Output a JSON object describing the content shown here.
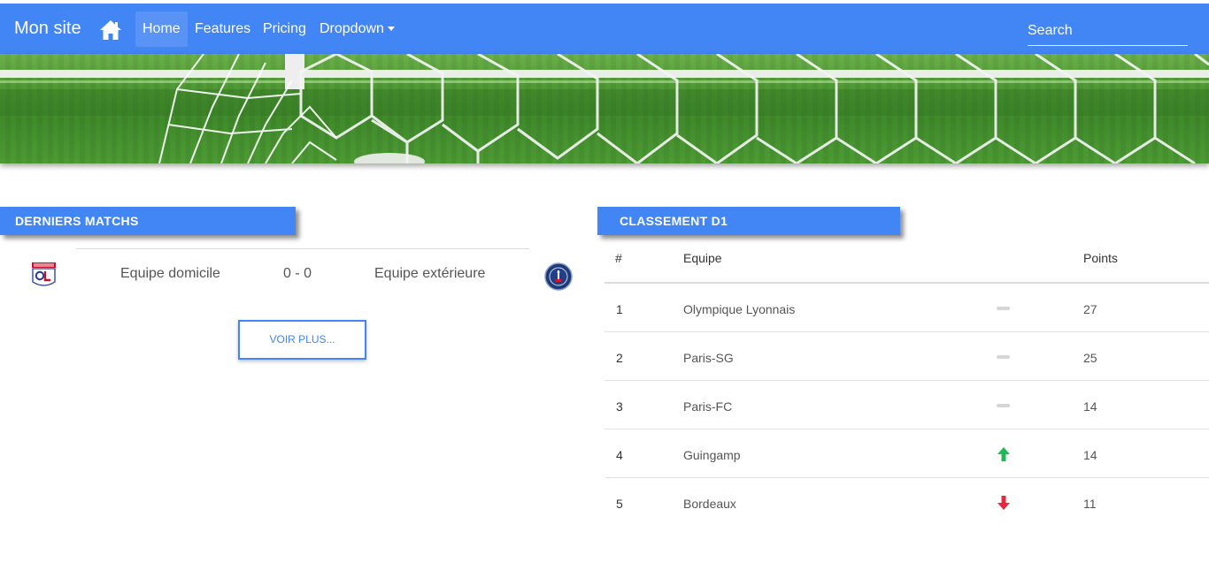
{
  "navbar": {
    "brand": "Mon site",
    "home_icon": "home-icon",
    "items": [
      {
        "label": "Home",
        "active": true
      },
      {
        "label": "Features"
      },
      {
        "label": "Pricing"
      },
      {
        "label": "Dropdown"
      }
    ],
    "search_placeholder": "Search",
    "color": "#4285f4"
  },
  "banner": {
    "alt": "soccer-goal-net-banner"
  },
  "matches": {
    "title": "DERNIERS MATCHS",
    "items": [
      {
        "home_logo": "ol-logo",
        "home": "Equipe domicile",
        "score": "0 - 0",
        "away": "Equipe extérieure",
        "away_logo": "psg-logo"
      }
    ],
    "more_label": "VOIR PLUS..."
  },
  "standings": {
    "title": "CLASSEMENT D1",
    "headers": [
      "#",
      "Equipe",
      "Points"
    ],
    "rows": [
      {
        "rank": "1",
        "team": "Olympique Lyonnais",
        "trend": "same",
        "points": "27"
      },
      {
        "rank": "2",
        "team": "Paris-SG",
        "trend": "same",
        "points": "25"
      },
      {
        "rank": "3",
        "team": "Paris-FC",
        "trend": "same",
        "points": "14"
      },
      {
        "rank": "4",
        "team": "Guingamp",
        "trend": "up",
        "points": "14"
      },
      {
        "rank": "5",
        "team": "Bordeaux",
        "trend": "down",
        "points": "11"
      }
    ],
    "trend_colors": {
      "up": "#1db954",
      "down": "#e8283a",
      "same": "#d6d6d6"
    }
  }
}
